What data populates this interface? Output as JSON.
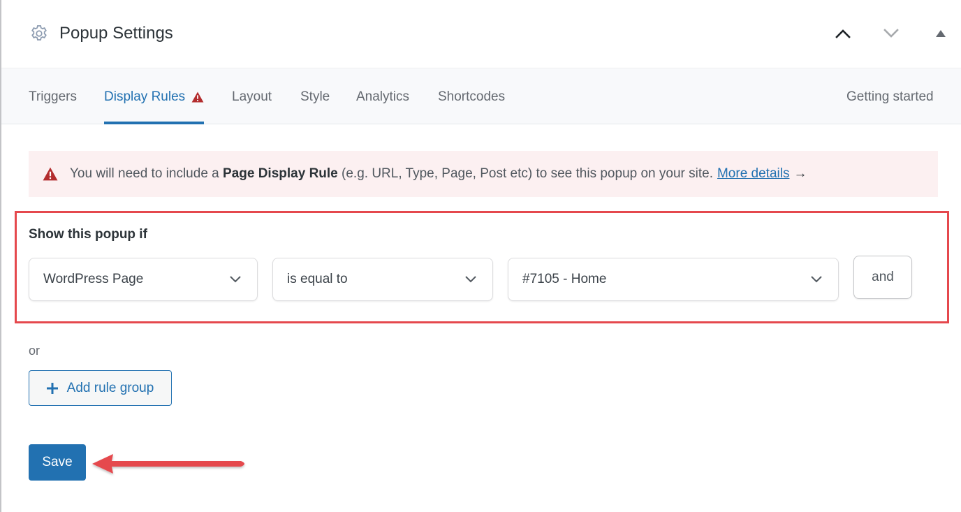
{
  "header": {
    "title": "Popup Settings",
    "icon": "gear-icon",
    "controls": [
      {
        "name": "move-up",
        "icon": "chevron-up-icon"
      },
      {
        "name": "move-down",
        "icon": "chevron-down-icon"
      },
      {
        "name": "toggle-panel",
        "icon": "triangle-up-icon"
      }
    ]
  },
  "tabs": [
    {
      "label": "Triggers",
      "active": false
    },
    {
      "label": "Display Rules",
      "active": true,
      "warning": true
    },
    {
      "label": "Layout",
      "active": false
    },
    {
      "label": "Style",
      "active": false
    },
    {
      "label": "Analytics",
      "active": false
    },
    {
      "label": "Shortcodes",
      "active": false
    },
    {
      "label": "Getting started",
      "active": false
    }
  ],
  "notice": {
    "icon": "warning-icon",
    "text_before": "You will need to include a",
    "bold": "Page Display Rule",
    "text_after": "(e.g. URL, Type, Page, Post etc) to see this popup on your site.",
    "link": "More details",
    "arrow": "→"
  },
  "rule_group": {
    "label": "Show this popup if",
    "condition": {
      "type": "WordPress Page",
      "operator": "is equal to",
      "value": "#7105 - Home"
    },
    "and_label": "and"
  },
  "or_label": "or",
  "add_rule_group_label": "Add rule group",
  "save_label": "Save",
  "colors": {
    "accent": "#2271b1",
    "warning": "#b32d2e",
    "notice_bg": "#fcf0f1",
    "annotation": "#e5484d"
  }
}
